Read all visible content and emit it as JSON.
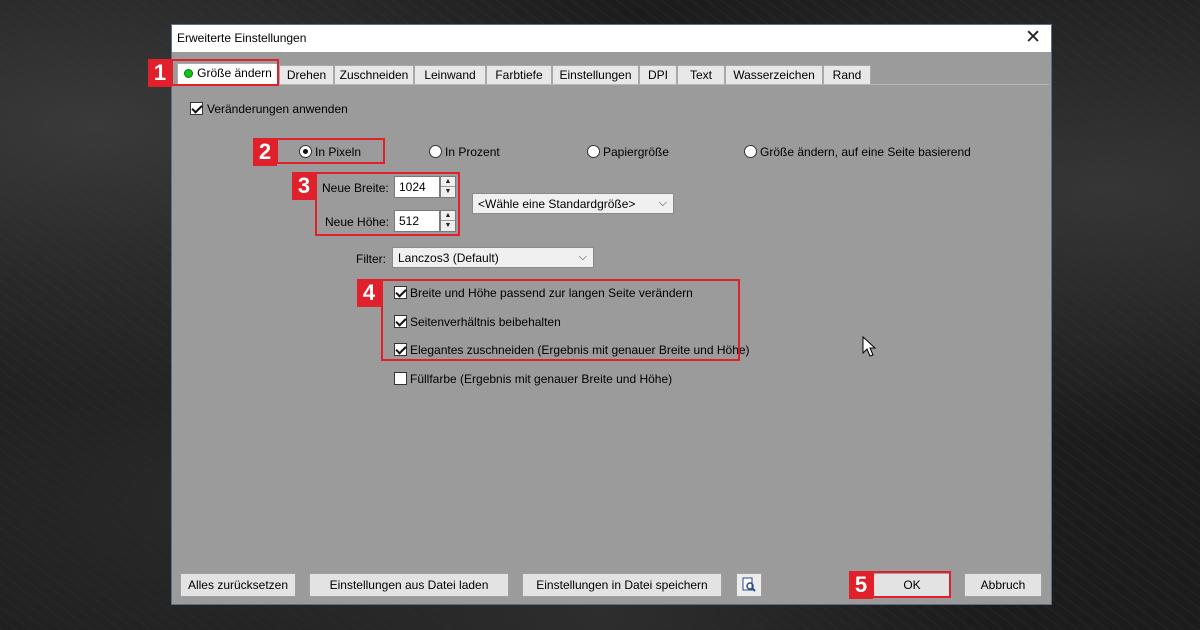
{
  "window": {
    "title": "Erweiterte Einstellungen"
  },
  "tabs": [
    {
      "label": "Größe ändern"
    },
    {
      "label": "Drehen"
    },
    {
      "label": "Zuschneiden"
    },
    {
      "label": "Leinwand"
    },
    {
      "label": "Farbtiefe"
    },
    {
      "label": "Einstellungen"
    },
    {
      "label": "DPI"
    },
    {
      "label": "Text"
    },
    {
      "label": "Wasserzeichen"
    },
    {
      "label": "Rand"
    }
  ],
  "apply_changes": {
    "label": "Veränderungen anwenden",
    "checked": true
  },
  "mode_options": [
    {
      "label": "In Pixeln",
      "selected": true
    },
    {
      "label": "In Prozent",
      "selected": false
    },
    {
      "label": "Papiergröße",
      "selected": false
    },
    {
      "label": "Größe ändern, auf eine Seite basierend",
      "selected": false
    }
  ],
  "size": {
    "width_label": "Neue Breite:",
    "width_value": "1024",
    "height_label": "Neue Höhe:",
    "height_value": "512",
    "preset_select": "<Wähle eine Standardgröße>"
  },
  "filter": {
    "label": "Filter:",
    "value": "Lanczos3 (Default)"
  },
  "options": [
    {
      "label": "Breite und Höhe passend zur langen Seite verändern",
      "checked": true
    },
    {
      "label": "Seitenverhältnis beibehalten",
      "checked": true
    },
    {
      "label": "Elegantes zuschneiden (Ergebnis mit genauer Breite und Höhe)",
      "checked": true
    },
    {
      "label": "Füllfarbe (Ergebnis mit genauer Breite und Höhe)",
      "checked": false
    }
  ],
  "footer": {
    "reset": "Alles zurücksetzen",
    "load": "Einstellungen aus Datei laden",
    "save": "Einstellungen in Datei speichern",
    "ok": "OK",
    "cancel": "Abbruch"
  },
  "badges": [
    "1",
    "2",
    "3",
    "4",
    "5"
  ],
  "colors": {
    "highlight": "#e0202a",
    "active_dot": "#15c415",
    "dialog_bg": "#9b9b9b"
  },
  "icons": {
    "close": "close-icon",
    "preview": "preview-search-icon"
  }
}
